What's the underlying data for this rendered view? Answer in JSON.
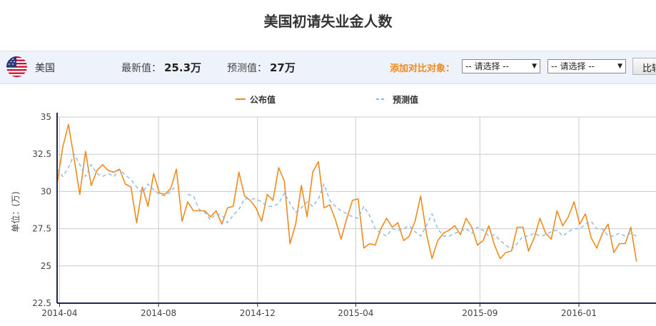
{
  "title": "美国初请失业金人数",
  "infobar": {
    "country": "美国",
    "flag_icon": "us-flag-icon",
    "latest_label": "最新值：",
    "latest_value": "25.3万",
    "forecast_label": "预测值：",
    "forecast_value": "27万",
    "compare_label": "添加对比对象：",
    "select1_value": "-- 请选择 --",
    "select2_value": "-- 请选择 --",
    "compare_button": "比较"
  },
  "colors": {
    "actual": "#f08a1c",
    "forecast": "#8ab8e6",
    "axis": "#1f2a4d",
    "grid": "#cccccc"
  },
  "chart_data": {
    "type": "line",
    "ylabel": "单位：(万)",
    "ylim": [
      22.5,
      35
    ],
    "yticks": [
      "22.5",
      "25",
      "27.5",
      "30",
      "32.5",
      "35"
    ],
    "xlim": [
      "2014-03-29",
      "2016-04-05"
    ],
    "xticks": [
      {
        "date": "2014-04-01",
        "label": "2014-04"
      },
      {
        "date": "2014-08-01",
        "label": "2014-08"
      },
      {
        "date": "2014-12-01",
        "label": "2014-12"
      },
      {
        "date": "2015-04-01",
        "label": "2015-04"
      },
      {
        "date": "2015-09-01",
        "label": "2015-09"
      },
      {
        "date": "2016-01-01",
        "label": "2016-01"
      }
    ],
    "grid": true,
    "legend_position": "top-center",
    "series": [
      {
        "name": "公布值",
        "style": "solid",
        "start_date": "2014-03-29",
        "interval_days": 7,
        "values": [
          30.5,
          33,
          34.5,
          32.2,
          29.8,
          32.7,
          30.4,
          31.4,
          31.8,
          31.4,
          31.3,
          31.5,
          30.5,
          30.3,
          27.9,
          30.3,
          29,
          31.2,
          29.9,
          29.8,
          30.2,
          31.5,
          28,
          29.3,
          28.7,
          28.7,
          28.7,
          28.3,
          28.7,
          27.8,
          28.9,
          29,
          31.3,
          29.7,
          29.4,
          28.9,
          28,
          29.8,
          29.4,
          31.6,
          30.7,
          26.5,
          27.8,
          30.4,
          28.3,
          31.3,
          32,
          28.9,
          29.1,
          28.1,
          26.8,
          28.2,
          29.4,
          29.5,
          26.2,
          26.5,
          26.4,
          27.5,
          28.2,
          27.6,
          27.9,
          26.7,
          27,
          28,
          29.7,
          27.2,
          25.5,
          26.7,
          27.2,
          27.4,
          27.7,
          27.1,
          28.2,
          27.6,
          26.4,
          26.7,
          27.7,
          26.4,
          25.5,
          25.9,
          26,
          27.6,
          27.6,
          26,
          26.9,
          28.2,
          27.2,
          26.8,
          28.7,
          27.7,
          28.3,
          29.3,
          27.8,
          28.5,
          26.9,
          26.2,
          27.2,
          27.8,
          25.9,
          26.5,
          26.5,
          27.6,
          25.3
        ]
      },
      {
        "name": "预测值",
        "style": "dashed",
        "start_date": "2014-03-29",
        "interval_days": 7,
        "values": [
          31.5,
          31,
          31.6,
          32.5,
          31.8,
          31,
          31.8,
          31.2,
          31,
          31.2,
          31,
          31.5,
          31.1,
          30.8,
          30.3,
          29.9,
          30.5,
          30.1,
          29.8,
          29.7,
          30,
          30.4,
          null,
          29.8,
          29.7,
          28.8,
          28.6,
          28.1,
          28.5,
          28.4,
          27.9,
          28.4,
          28.8,
          29.5,
          29.5,
          29.5,
          29.3,
          29,
          29,
          29.2,
          29.9,
          29.2,
          28.6,
          28.9,
          29.3,
          29,
          29.5,
          30.5,
          29.4,
          29,
          28.7,
          28.5,
          28.3,
          28.2,
          29,
          28.4,
          27.5,
          27.2,
          27,
          27.5,
          27.4,
          27.5,
          27.7,
          27.3,
          27,
          27.7,
          28.5,
          27.5,
          27,
          27,
          27.2,
          27.3,
          27.5,
          27.2,
          27.6,
          27.4,
          27,
          27.1,
          26.7,
          26.4,
          26.1,
          26.5,
          27,
          27,
          27.2,
          27,
          27.1,
          27.3,
          27.4,
          27,
          27.3,
          27.5,
          27.5,
          27.8,
          28,
          27.5,
          27.5,
          27,
          27,
          27.2,
          27,
          27.2,
          27
        ]
      }
    ]
  }
}
